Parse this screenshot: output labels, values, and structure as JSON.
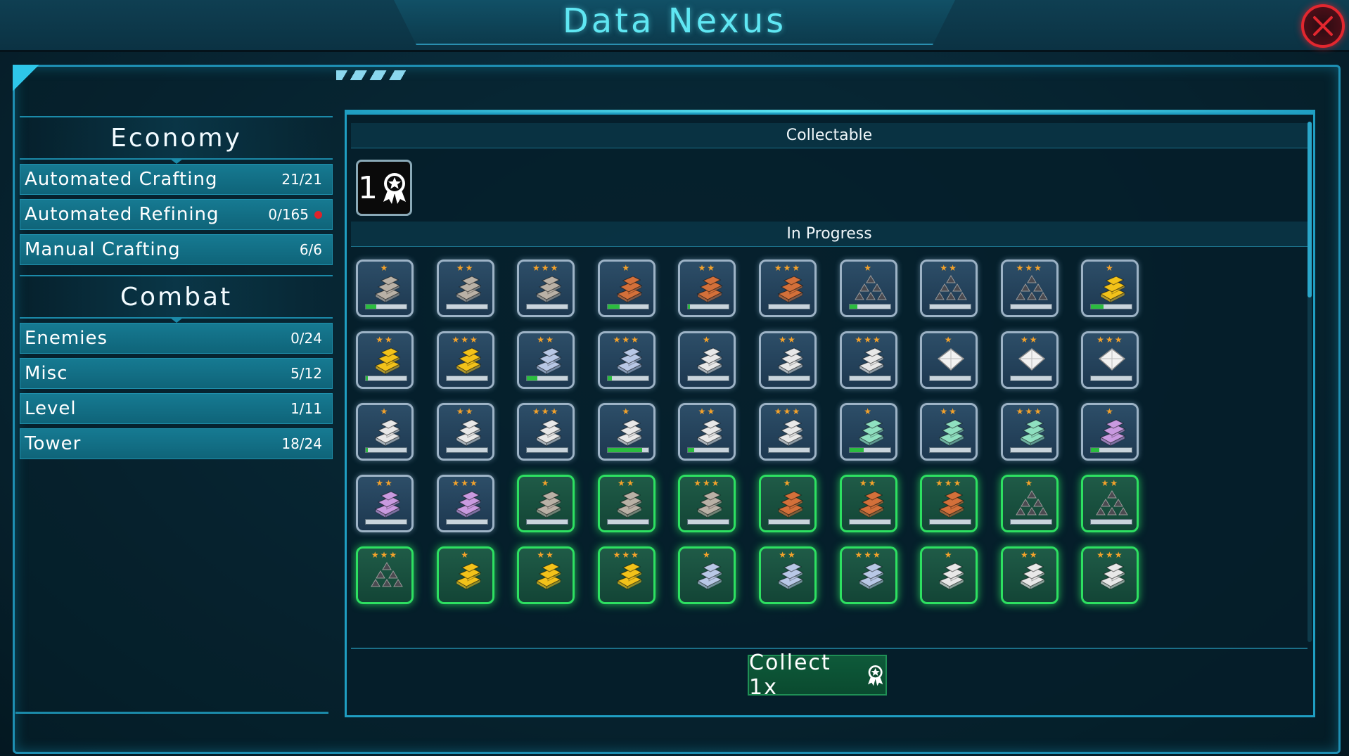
{
  "header": {
    "title": "Data Nexus"
  },
  "sidebar": {
    "economy": {
      "title": "Economy",
      "items": [
        {
          "label": "Automated Crafting",
          "count": "21/21",
          "alert": false
        },
        {
          "label": "Automated Refining",
          "count": "0/165",
          "alert": true
        },
        {
          "label": "Manual Crafting",
          "count": "6/6",
          "alert": false
        }
      ]
    },
    "combat": {
      "title": "Combat",
      "items": [
        {
          "label": "Enemies",
          "count": "0/24"
        },
        {
          "label": "Misc",
          "count": "5/12"
        },
        {
          "label": "Level",
          "count": "1/11"
        },
        {
          "label": "Tower",
          "count": "18/24"
        }
      ]
    }
  },
  "content": {
    "collectable_label": "Collectable",
    "collectable_count": "1",
    "in_progress_label": "In Progress",
    "collect_button": "Collect 1x"
  },
  "colors": {
    "iron": "#b9b1a6",
    "copper": "#d3703a",
    "coal": "#4a4a50",
    "gold": "#f2c21a",
    "silver_blue": "#b8c8e6",
    "white": "#e8e8e8",
    "diamond": "#f2f2f2",
    "mint": "#8fe0c0",
    "violet": "#c99ae0",
    "complete_glow": "#2de061"
  },
  "tiles": [
    {
      "material": "iron",
      "stars": 1,
      "progress": 0.25,
      "complete": false
    },
    {
      "material": "iron",
      "stars": 2,
      "progress": 0,
      "complete": false
    },
    {
      "material": "iron",
      "stars": 3,
      "progress": 0,
      "complete": false
    },
    {
      "material": "copper",
      "stars": 1,
      "progress": 0.3,
      "complete": false
    },
    {
      "material": "copper",
      "stars": 2,
      "progress": 0.05,
      "complete": false
    },
    {
      "material": "copper",
      "stars": 3,
      "progress": 0,
      "complete": false
    },
    {
      "material": "coal",
      "stars": 1,
      "progress": 0.2,
      "complete": false
    },
    {
      "material": "coal",
      "stars": 2,
      "progress": 0,
      "complete": false
    },
    {
      "material": "coal",
      "stars": 3,
      "progress": 0,
      "complete": false
    },
    {
      "material": "gold",
      "stars": 1,
      "progress": 0.3,
      "complete": false
    },
    {
      "material": "gold",
      "stars": 2,
      "progress": 0.05,
      "complete": false
    },
    {
      "material": "gold",
      "stars": 3,
      "progress": 0,
      "complete": false
    },
    {
      "material": "silver_blue",
      "stars": 2,
      "progress": 0.25,
      "complete": false
    },
    {
      "material": "silver_blue",
      "stars": 3,
      "progress": 0.1,
      "complete": false
    },
    {
      "material": "white",
      "stars": 1,
      "progress": 0,
      "complete": false
    },
    {
      "material": "white",
      "stars": 2,
      "progress": 0,
      "complete": false
    },
    {
      "material": "white",
      "stars": 3,
      "progress": 0,
      "complete": false
    },
    {
      "material": "diamond",
      "stars": 1,
      "progress": 0,
      "complete": false
    },
    {
      "material": "diamond",
      "stars": 2,
      "progress": 0,
      "complete": false
    },
    {
      "material": "diamond",
      "stars": 3,
      "progress": 0,
      "complete": false
    },
    {
      "material": "white",
      "stars": 1,
      "progress": 0.05,
      "complete": false
    },
    {
      "material": "white",
      "stars": 2,
      "progress": 0,
      "complete": false
    },
    {
      "material": "white",
      "stars": 3,
      "progress": 0,
      "complete": false
    },
    {
      "material": "white",
      "stars": 1,
      "progress": 0.85,
      "complete": false
    },
    {
      "material": "white",
      "stars": 2,
      "progress": 0.15,
      "complete": false
    },
    {
      "material": "white",
      "stars": 3,
      "progress": 0,
      "complete": false
    },
    {
      "material": "mint",
      "stars": 1,
      "progress": 0.35,
      "complete": false
    },
    {
      "material": "mint",
      "stars": 2,
      "progress": 0,
      "complete": false
    },
    {
      "material": "mint",
      "stars": 3,
      "progress": 0,
      "complete": false
    },
    {
      "material": "violet",
      "stars": 1,
      "progress": 0.2,
      "complete": false
    },
    {
      "material": "violet",
      "stars": 2,
      "progress": 0,
      "complete": false
    },
    {
      "material": "violet",
      "stars": 3,
      "progress": 0,
      "complete": false
    },
    {
      "material": "iron",
      "stars": 1,
      "progress": 0,
      "complete": true
    },
    {
      "material": "iron",
      "stars": 2,
      "progress": 0,
      "complete": true
    },
    {
      "material": "iron",
      "stars": 3,
      "progress": 0,
      "complete": true
    },
    {
      "material": "copper",
      "stars": 1,
      "progress": 0,
      "complete": true
    },
    {
      "material": "copper",
      "stars": 2,
      "progress": 0,
      "complete": true
    },
    {
      "material": "copper",
      "stars": 3,
      "progress": 0,
      "complete": true
    },
    {
      "material": "coal",
      "stars": 1,
      "progress": 0,
      "complete": true
    },
    {
      "material": "coal",
      "stars": 2,
      "progress": 0,
      "complete": true
    },
    {
      "material": "coal",
      "stars": 3,
      "progress": 0,
      "complete": true
    },
    {
      "material": "gold",
      "stars": 1,
      "progress": 0,
      "complete": true
    },
    {
      "material": "gold",
      "stars": 2,
      "progress": 0,
      "complete": true
    },
    {
      "material": "gold",
      "stars": 3,
      "progress": 0,
      "complete": true
    },
    {
      "material": "silver_blue",
      "stars": 1,
      "progress": 0,
      "complete": true
    },
    {
      "material": "silver_blue",
      "stars": 2,
      "progress": 0,
      "complete": true
    },
    {
      "material": "silver_blue",
      "stars": 3,
      "progress": 0,
      "complete": true
    },
    {
      "material": "white",
      "stars": 1,
      "progress": 0,
      "complete": true
    },
    {
      "material": "white",
      "stars": 2,
      "progress": 0,
      "complete": true
    },
    {
      "material": "white",
      "stars": 3,
      "progress": 0,
      "complete": true
    }
  ]
}
